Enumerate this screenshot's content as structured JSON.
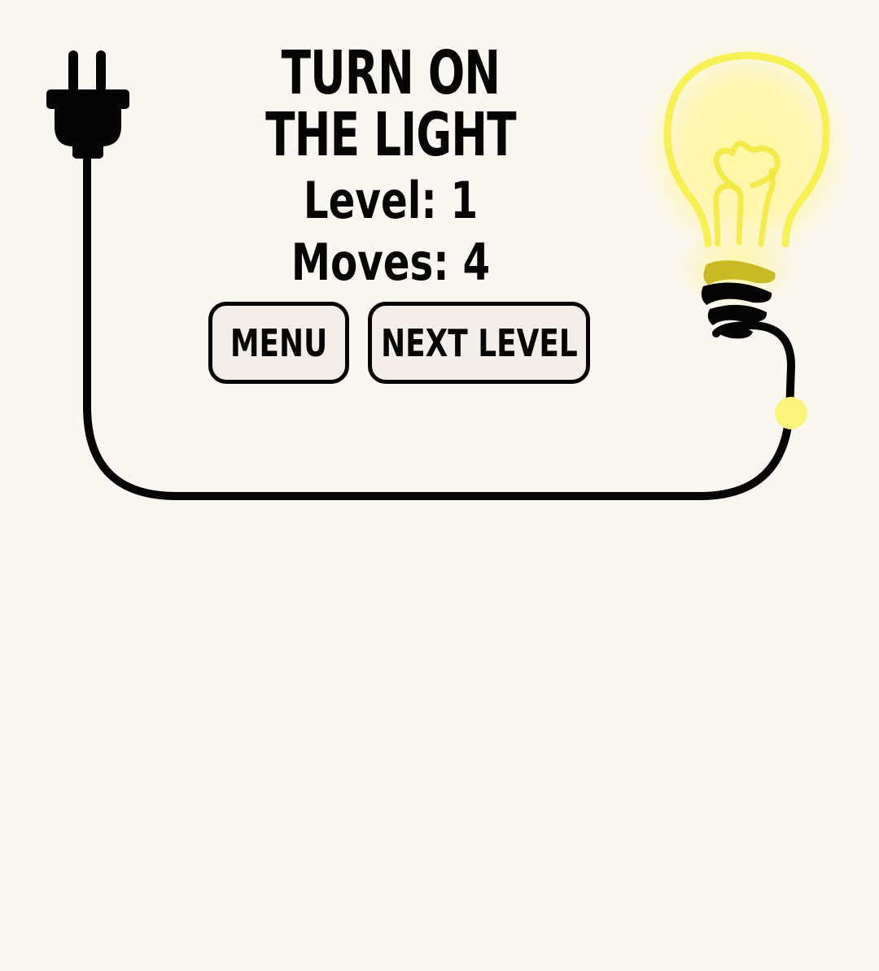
{
  "title": {
    "line1": "TURN ON",
    "line2": "THE LIGHT"
  },
  "status": {
    "level_text": "Level: 1",
    "moves_text": "Moves: 4",
    "level": 1,
    "moves": 4
  },
  "buttons": {
    "menu_label": "MENU",
    "next_level_label": "NEXT LEVEL"
  },
  "icons": {
    "plug": "plug-icon",
    "bulb": "light-bulb-icon",
    "connector": "connector-node-icon"
  },
  "colors": {
    "background": "#faf7f3",
    "ink": "#050505",
    "button_fill": "#f3eee9",
    "bulb_glow": "#fff27a",
    "bulb_filament": "#f5ee3a",
    "connector": "#fdf47e"
  },
  "state": {
    "bulb_lit": true
  }
}
